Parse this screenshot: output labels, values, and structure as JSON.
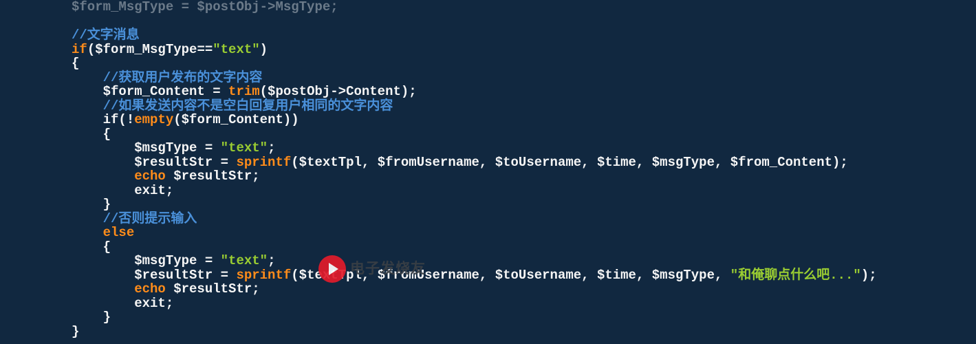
{
  "watermark_text": "电子发烧友",
  "code": {
    "l0": "$form_MsgType = $postObj->MsgType;",
    "l1": "//文字消息",
    "l2a": "if",
    "l2b": "($form_MsgType==",
    "l2c": "\"text\"",
    "l2d": ")",
    "l3": "{",
    "l4": "    //获取用户发布的文字内容",
    "l5a": "    $form_Content = ",
    "l5b": "trim",
    "l5c": "($postObj->Content);",
    "l6": "    //如果发送内容不是空白回复用户相同的文字内容",
    "l7a": "    if",
    "l7b": "(!",
    "l7c": "empty",
    "l7d": "($form_Content))",
    "l8": "    {",
    "l9a": "        $msgType = ",
    "l9b": "\"text\"",
    "l9c": ";",
    "l10a": "        $resultStr = ",
    "l10b": "sprintf",
    "l10c": "($textTpl, $fromUsername, $toUsername, $time, $msgType, $from_Content);",
    "l11a": "        echo",
    "l11b": " $resultStr;",
    "l12": "        exit;",
    "l13": "    }",
    "l14": "    //否则提示输入",
    "l15": "    else",
    "l16": "    {",
    "l17a": "        $msgType = ",
    "l17b": "\"text\"",
    "l17c": ";",
    "l18a": "        $resultStr = ",
    "l18b": "sprintf",
    "l18c": "($textTpl, $fromUsername, $toUsername, $time, $msgType, ",
    "l18d": "\"和俺聊点什么吧...\"",
    "l18e": ");",
    "l19a": "        echo",
    "l19b": " $resultStr;",
    "l20": "        exit;",
    "l21": "    }",
    "l22": "}"
  }
}
